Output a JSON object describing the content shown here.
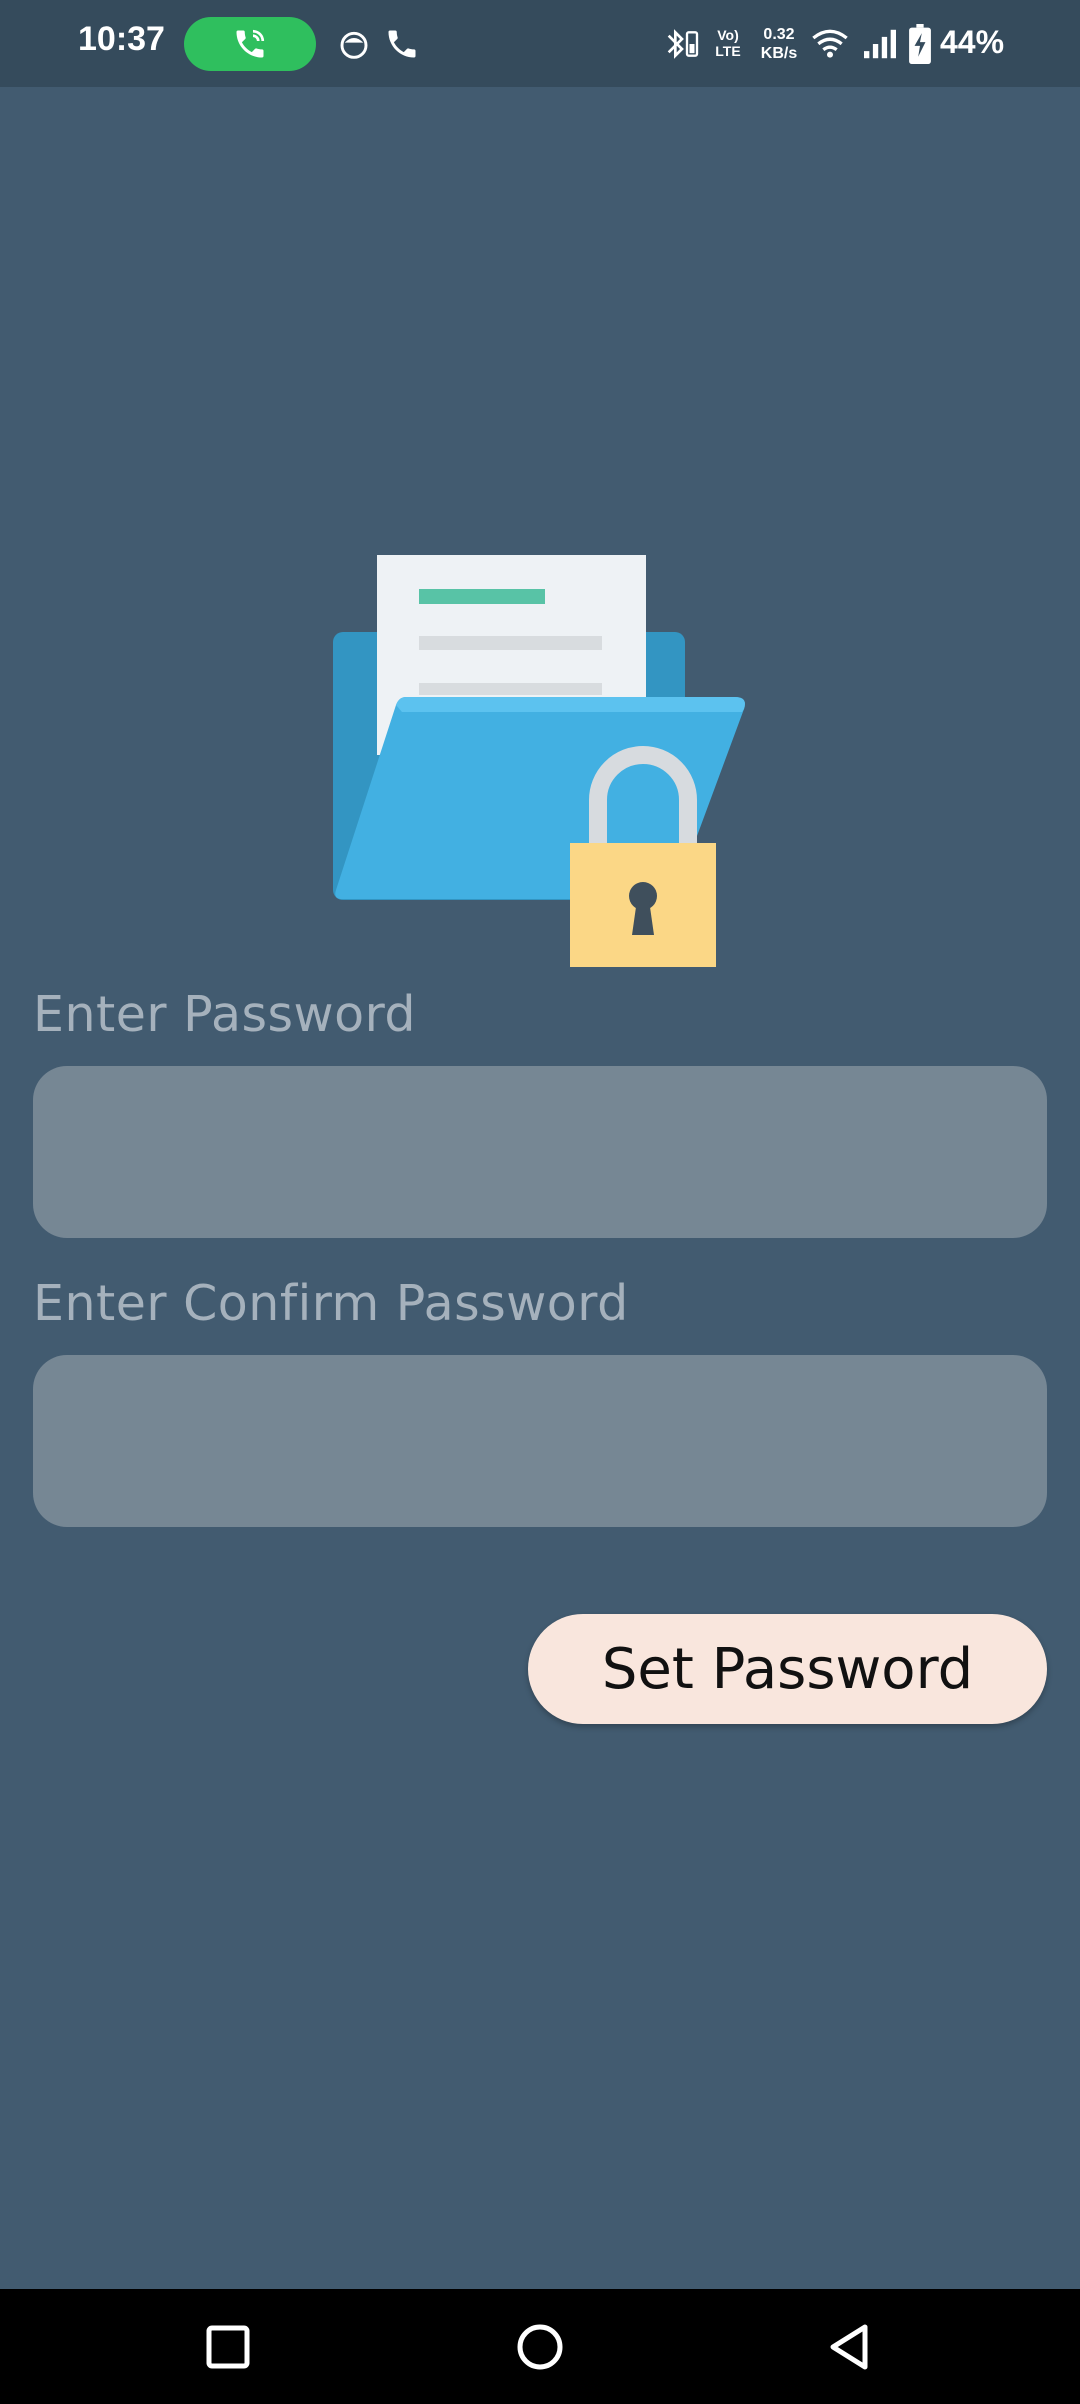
{
  "status_bar": {
    "time": "10:37",
    "volte_line1": "Vo)",
    "volte_line2": "LTE",
    "net_speed_value": "0.32",
    "net_speed_unit": "KB/s",
    "battery_percent": "44%",
    "icons": [
      "call-active-icon",
      "app-notification-icon",
      "phone-icon",
      "bluetooth-battery-icon",
      "wifi-icon",
      "cell-signal-icon",
      "battery-charging-icon"
    ]
  },
  "illustration": {
    "icon": "locked-folder-icon",
    "colors": {
      "folder_back": "#3395c2",
      "folder_front": "#42b0e2",
      "paper": "#eef2f5",
      "paper_accent": "#58c3a6",
      "lock_body": "#fbd786",
      "lock_shackle": "#d7dbdf",
      "keyhole": "#3f4f5c"
    }
  },
  "form": {
    "password_label": "Enter Password",
    "password_value": "",
    "confirm_label": "Enter Confirm Password",
    "confirm_value": "",
    "submit_label": "Set Password"
  },
  "nav_bar": {
    "icons": [
      "recent-apps-icon",
      "home-icon",
      "back-icon"
    ]
  },
  "colors": {
    "background": "#425b70",
    "status_bar": "#354b5c",
    "input_fill": "#768794",
    "label_text": "#a5b1bc",
    "button_fill": "#f9e6dd",
    "call_pill": "#2fbf5e"
  }
}
